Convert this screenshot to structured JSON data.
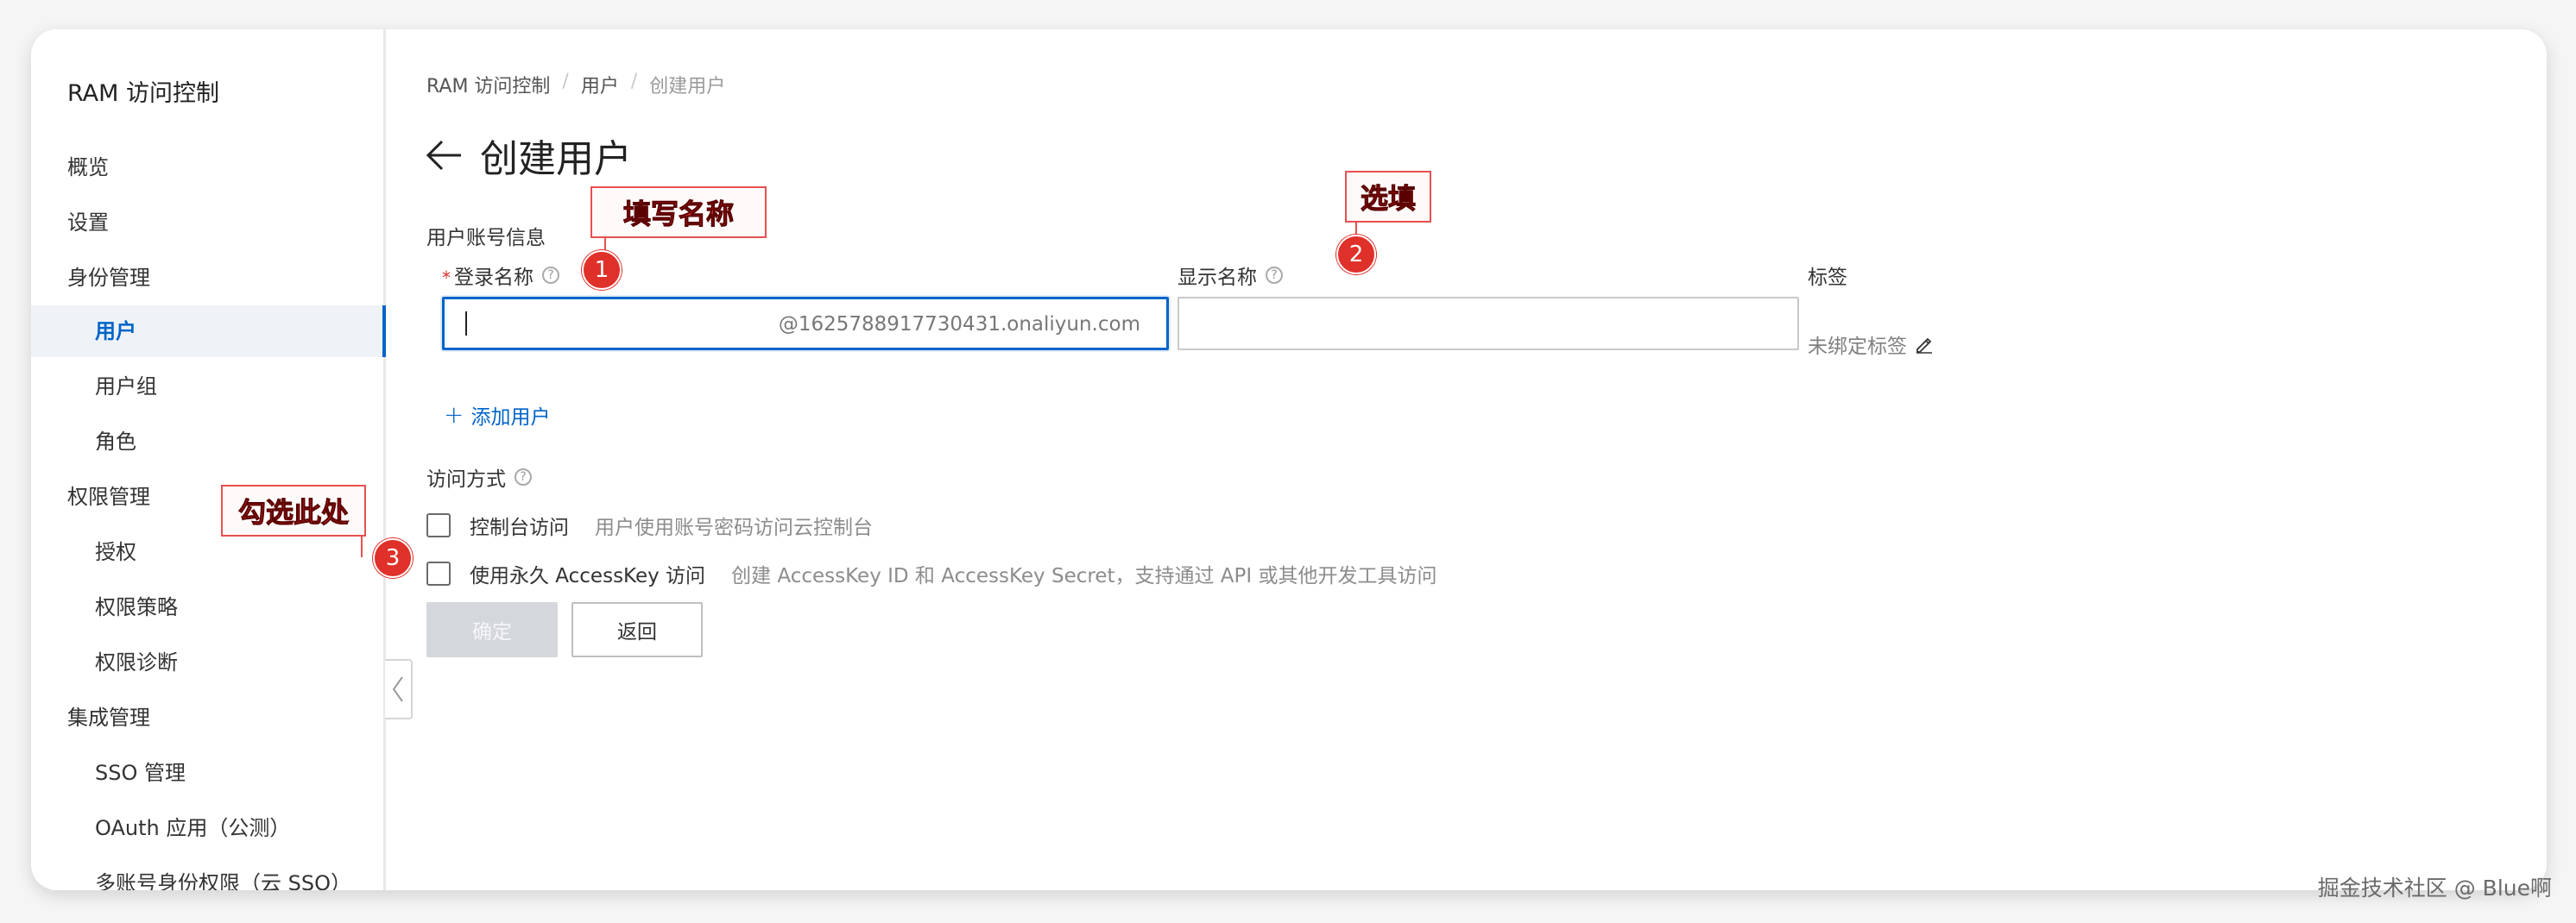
{
  "sidebar": {
    "title": "RAM 访问控制",
    "items": [
      {
        "label": "概览"
      },
      {
        "label": "设置"
      },
      {
        "label": "身份管理"
      },
      {
        "label": "用户"
      },
      {
        "label": "用户组"
      },
      {
        "label": "角色"
      },
      {
        "label": "权限管理"
      },
      {
        "label": "授权"
      },
      {
        "label": "权限策略"
      },
      {
        "label": "权限诊断"
      },
      {
        "label": "集成管理"
      },
      {
        "label": "SSO 管理"
      },
      {
        "label": "OAuth 应用（公测）"
      },
      {
        "label": "多账号身份权限（云 SSO）"
      }
    ]
  },
  "breadcrumb": {
    "items": [
      "RAM 访问控制",
      "用户",
      "创建用户"
    ],
    "separator": "/"
  },
  "page": {
    "title": "创建用户"
  },
  "form": {
    "section_title": "用户账号信息",
    "login_name": {
      "required_mark": "*",
      "label": "登录名称",
      "value": "",
      "suffix": "@1625788917730431.onaliyun.com"
    },
    "display_name": {
      "label": "显示名称",
      "value": ""
    },
    "tags": {
      "label": "标签",
      "value": "未绑定标签"
    },
    "add_user_label": "添加用户",
    "access_section_title": "访问方式",
    "access_options": [
      {
        "label": "控制台访问",
        "description": "用户使用账号密码访问云控制台",
        "checked": false
      },
      {
        "label": "使用永久 AccessKey 访问",
        "description": "创建 AccessKey ID 和 AccessKey Secret，支持通过 API 或其他开发工具访问",
        "checked": false
      }
    ],
    "confirm_label": "确定",
    "back_label": "返回"
  },
  "annotations": {
    "callout1": "填写名称",
    "callout2": "选填",
    "callout3": "勾选此处",
    "badges": [
      "1",
      "2",
      "3"
    ]
  },
  "watermark": "掘金技术社区 @ Blue啊",
  "colors": {
    "accent": "#0064c8",
    "annotation_red": "#e0302a",
    "disabled_button": "#d4d8dc"
  }
}
